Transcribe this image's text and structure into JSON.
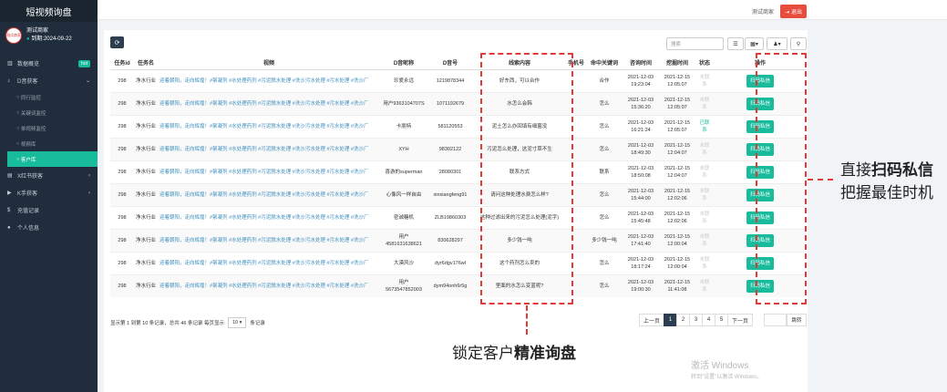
{
  "app": {
    "title": "短视频询盘"
  },
  "user": {
    "name": "测试商家",
    "expiry": "到期:2024-09-22",
    "avatar_text": "测试商家"
  },
  "sidebar": {
    "items": [
      {
        "label": "数据概览",
        "badge": "hot",
        "icon": "chart-icon"
      },
      {
        "label": "D音获客",
        "icon": "music-icon",
        "expanded": true
      },
      {
        "label": "X红书获客",
        "icon": "book-icon"
      },
      {
        "label": "K手获客",
        "icon": "video-icon"
      },
      {
        "label": "充值记录",
        "icon": "wallet-icon"
      },
      {
        "label": "个人信息",
        "icon": "user-icon"
      }
    ],
    "subitems": [
      "同行监控",
      "关键词监控",
      "单视频监控",
      "视频库",
      "客户库"
    ],
    "active_subitem": "客户库"
  },
  "topbar": {
    "shop_label": "测试商家",
    "logout_label": "退出"
  },
  "toolbar": {
    "search_placeholder": "搜索"
  },
  "table": {
    "headers": [
      "任务id",
      "任务名",
      "视频",
      "D音昵称",
      "D音号",
      "线索内容",
      "手机号",
      "命中关键词",
      "咨询时间",
      "挖掘时间",
      "状态",
      "操作"
    ],
    "action_label": "扫码私信",
    "rows": [
      {
        "id": "298",
        "task": "净水行业",
        "video": "迎着朝阳，走向辉煌！#絮凝剂 #水处理药剂 #污泥脱水处理 #洗沙污水处理 #污水处理 #洗沙厂",
        "nick": "珍爱永远",
        "dyid": "1219878344",
        "content": "好东西，可以合作",
        "phone": "",
        "keyword": "合作",
        "consult": "2021-12-03 19:23:04",
        "mined": "2021-12-15 12:05:07",
        "status": "未联系"
      },
      {
        "id": "298",
        "task": "净水行业",
        "video": "迎着朝阳，走向辉煌！#絮凝剂 #水处理药剂 #污泥脱水处理 #洗沙污水处理 #污水处理 #洗沙厂",
        "nick": "用户9363104707S",
        "dyid": "1071192679",
        "content": "水怎么会韩",
        "phone": "",
        "keyword": "怎么",
        "consult": "2021-12-03 15:36:20",
        "mined": "2021-12-15 12:05:07",
        "status": "未联系"
      },
      {
        "id": "298",
        "task": "净水行业",
        "video": "迎着朝阳，走向辉煌！#絮凝剂 #水处理药剂 #污泥脱水处理 #洗沙污水处理 #污水处理 #洗沙厂",
        "nick": "卡朋特",
        "dyid": "581120553",
        "content": "泥土怎么办回填有细菌没",
        "phone": "",
        "keyword": "怎么",
        "consult": "2021-12-03 16:21:24",
        "mined": "2021-12-15 12:05:07",
        "status": "已联系"
      },
      {
        "id": "298",
        "task": "净水行业",
        "video": "迎着朝阳，走向辉煌！#絮凝剂 #水处理药剂 #污泥脱水处理 #洗沙污水处理 #污水处理 #洗沙厂",
        "nick": "XYH",
        "dyid": "98302122",
        "content": "污泥怎么处理，这泥寸草不生",
        "phone": "",
        "keyword": "怎么",
        "consult": "2021-12-03 18:49:30",
        "mined": "2021-12-15 12:04:07",
        "status": "未联系"
      },
      {
        "id": "298",
        "task": "净水行业",
        "video": "迎着朝阳，走向辉煌！#絮凝剂 #水处理药剂 #污泥脱水处理 #洗沙污水处理 #污水处理 #洗沙厂",
        "nick": "喜游的superman",
        "dyid": "28080301",
        "content": "联系方式",
        "phone": "",
        "keyword": "联系",
        "consult": "2021-12-03 18:50:08",
        "mined": "2021-12-15 12:04:07",
        "status": "未联系"
      },
      {
        "id": "298",
        "task": "净水行业",
        "video": "迎着朝阳，走向辉煌！#絮凝剂 #水处理药剂 #污泥脱水处理 #洗沙污水处理 #污水处理 #洗沙厂",
        "nick": "心像风一样自由",
        "dyid": "xinxiangfeng91",
        "content": "请问这种处理水费怎么样?",
        "phone": "",
        "keyword": "怎么",
        "consult": "2021-12-03 15:44:00",
        "mined": "2021-12-15 12:02:06",
        "status": "未联系"
      },
      {
        "id": "298",
        "task": "净水行业",
        "video": "迎着朝阳，走向辉煌！#絮凝剂 #水处理药剂 #污泥脱水处理 #洗沙污水处理 #污水处理 #洗沙厂",
        "nick": "密诚糖机",
        "dyid": "ZLB19860303",
        "content": "这种过滤出来的污泥怎么处理(泥字)",
        "phone": "",
        "keyword": "怎么",
        "consult": "2021-12-03 15:45:48",
        "mined": "2021-12-15 12:02:06",
        "status": "未联系"
      },
      {
        "id": "298",
        "task": "净水行业",
        "video": "迎着朝阳，走向辉煌！#絮凝剂 #水处理药剂 #污泥脱水处理 #洗沙污水处理 #污水处理 #洗沙厂",
        "nick": "用户4581631638621",
        "dyid": "830628297",
        "content": "多少钱一吨",
        "phone": "",
        "keyword": "多少钱一吨",
        "consult": "2021-12-03 17:41:40",
        "mined": "2021-12-15 12:00:04",
        "status": "未联系"
      },
      {
        "id": "298",
        "task": "净水行业",
        "video": "迎着朝阳，走向辉煌！#絮凝剂 #水处理药剂 #污泥脱水处理 #洗沙污水处理 #污水处理 #洗沙厂",
        "nick": "大漠风沙",
        "dyid": "dyr6dgv176wl",
        "content": "这个药剂怎么卖的",
        "phone": "",
        "keyword": "怎么",
        "consult": "2021-12-03 18:17:24",
        "mined": "2021-12-15 12:00:04",
        "status": "未联系"
      },
      {
        "id": "298",
        "task": "净水行业",
        "video": "迎着朝阳，走向辉煌！#絮凝剂 #水处理药剂 #污泥脱水处理 #洗沙污水处理 #污水处理 #洗沙厂",
        "nick": "用户5673547852003",
        "dyid": "dym94onh6r5g",
        "content": "里面的水怎么变蓝呢?",
        "phone": "",
        "keyword": "怎么",
        "consult": "2021-12-03 19:00:30",
        "mined": "2021-12-15 11:41:08",
        "status": "未联系"
      }
    ]
  },
  "pagination": {
    "info_prefix": "显示第 1 到第 10 条记录，总共 46 条记录 每页显示",
    "page_size": "10",
    "info_suffix": "条记录",
    "prev": "上一页",
    "pages": [
      "1",
      "2",
      "3",
      "4",
      "5"
    ],
    "active_page": "1",
    "next": "下一页",
    "jump": "跳转"
  },
  "annotations": {
    "content_note_a": "锁定客户",
    "content_note_b": "精准询盘",
    "action_note_l1a": "直接",
    "action_note_l1b": "扫码私信",
    "action_note_l2": "把握最佳时机"
  },
  "watermark": {
    "line1": "激活 Windows",
    "line2": "转到\"设置\"以激活 Windows。"
  },
  "colors": {
    "sidebar": "#1f2d3d",
    "accent": "#18bc9c",
    "danger": "#e74c3c",
    "link": "#3c8dbc",
    "annotation": "#e53935"
  }
}
